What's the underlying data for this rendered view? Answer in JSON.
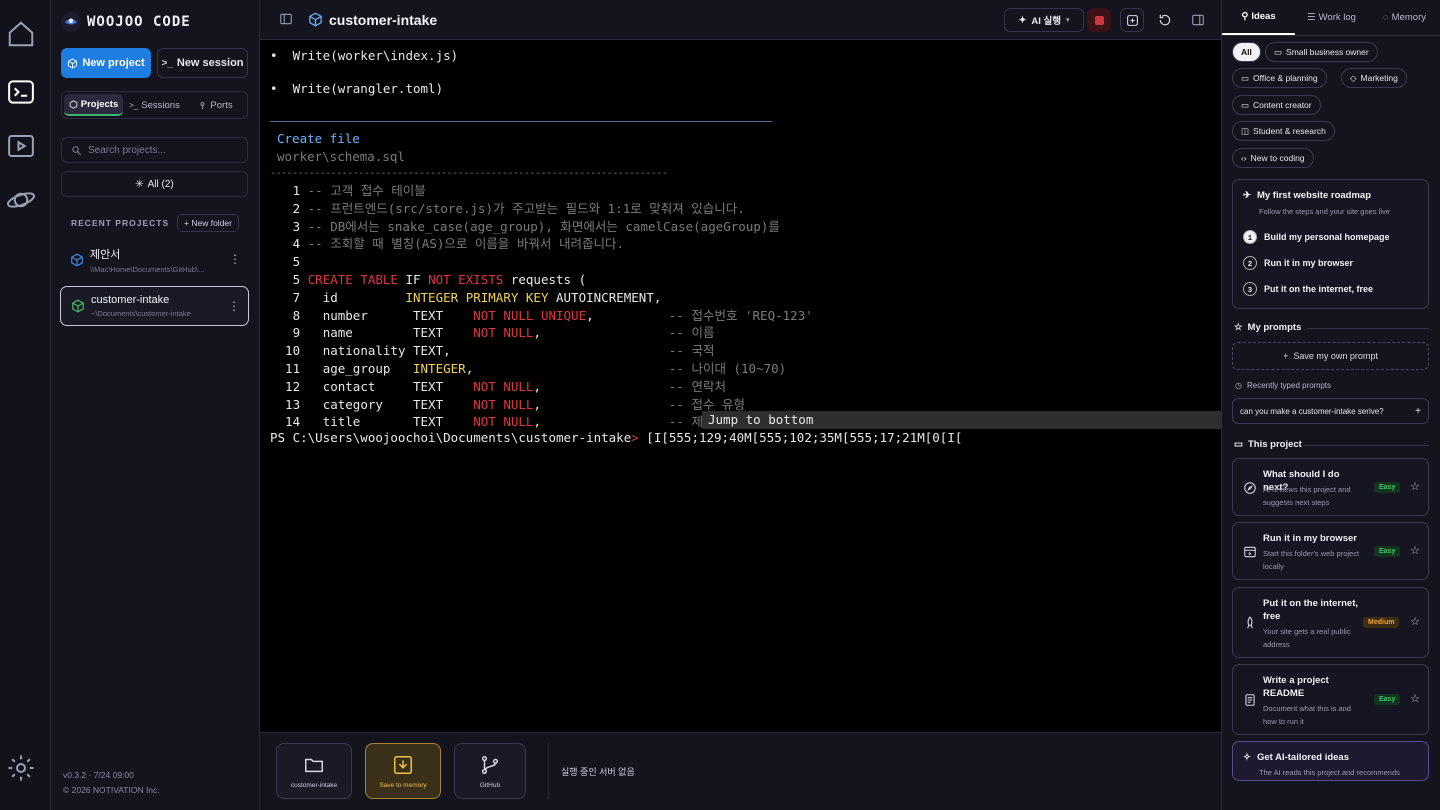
{
  "app": {
    "logo_text": "WOOJOO CODE",
    "version_line": "v0.3.2 · 7/24 09:00",
    "copyright": "© 2026 NOTIVATION Inc."
  },
  "sidebar": {
    "new_project": "New project",
    "new_session": "New session",
    "tabs": [
      {
        "label": "Projects",
        "icon": "cube-icon",
        "active": true
      },
      {
        "label": "Sessions",
        "icon": "terminal-icon",
        "active": false
      },
      {
        "label": "Ports",
        "icon": "pin-icon",
        "active": false
      }
    ],
    "search_placeholder": "Search projects...",
    "filter_label": "All (2)",
    "recent_label": "RECENT PROJECTS",
    "new_folder": "+ New folder",
    "projects": [
      {
        "name": "제안서",
        "path": "\\\\Mac\\Home\\Documents\\GitHub\\...",
        "color": "#3a8ee8",
        "selected": false
      },
      {
        "name": "customer-intake",
        "path": "~\\Documents\\customer-intake",
        "color": "#3ec36e",
        "selected": true
      }
    ]
  },
  "main": {
    "title": "customer-intake",
    "ai_run": "AI 실행",
    "terminal": {
      "write_lines": [
        "Write(worker\\index.js)",
        "Write(wrangler.toml)"
      ],
      "create_file": "Create file",
      "file_path": "worker\\schema.sql",
      "dashes": "------------------------------------------------------------------------",
      "code": [
        {
          "n": "1",
          "comment": "-- 고객 접수 테이블"
        },
        {
          "n": "2",
          "comment": "-- 프런트엔드(src/store.js)가 주고받는 필드와 1:1로 맞춰져 있습니다."
        },
        {
          "n": "3",
          "comment": "-- DB에서는 snake_case(age_group), 화면에서는 camelCase(ageGroup)를"
        },
        {
          "n": "4",
          "comment": "-- 조회할 때 별칭(AS)으로 이름을 바꿔서 내려줍니다."
        },
        {
          "n": "5",
          "comment": ""
        },
        {
          "n": "5",
          "create": "CREATE TABLE",
          "ifw": " IF ",
          "notexists": "NOT EXISTS",
          "rest": " requests ("
        },
        {
          "n": "7",
          "field": "  id         ",
          "type": "INTEGER PRIMARY KEY",
          "extra": " AUTOINCREMENT,",
          "c": ""
        },
        {
          "n": "8",
          "field": "  number      ",
          "plain": "TEXT    ",
          "kw": "NOT NULL UNIQUE",
          "tail": ",          ",
          "c": "-- 접수번호 'REQ-123'"
        },
        {
          "n": "9",
          "field": "  name        ",
          "plain": "TEXT    ",
          "kw": "NOT NULL",
          "tail": ",                 ",
          "c": "-- 이름"
        },
        {
          "n": "10",
          "field": "  nationality ",
          "plain": "TEXT,",
          "kw": "",
          "tail": "                             ",
          "c": "-- 국적"
        },
        {
          "n": "11",
          "field": "  age_group   ",
          "ytype": "INTEGER",
          "tail": ",                          ",
          "c": "-- 나이대 (10~70)"
        },
        {
          "n": "12",
          "field": "  contact     ",
          "plain": "TEXT    ",
          "kw": "NOT NULL",
          "tail": ",                 ",
          "c": "-- 연락처"
        },
        {
          "n": "13",
          "field": "  category    ",
          "plain": "TEXT    ",
          "kw": "NOT NULL",
          "tail": ",                 ",
          "c": "-- 접수 유형"
        },
        {
          "n": "14",
          "field": "  title       ",
          "plain": "TEXT    ",
          "kw": "NOT NULL",
          "tail": ",                 ",
          "c": "-- 제"
        }
      ],
      "jump_to_bottom": "Jump to bottom",
      "prompt": "PS C:\\Users\\woojoochoi\\Documents\\customer-intake",
      "prompt_tail": " [I[555;129;40M[555;102;35M[555;17;21M[0[I["
    },
    "dock": [
      {
        "label": "customer-intake",
        "icon": "folder-icon"
      },
      {
        "label": "Save to memory",
        "icon": "download-box-icon"
      },
      {
        "label": "GitHub",
        "icon": "git-branch-icon"
      }
    ],
    "server_status": "실행 중인 서버 없음"
  },
  "right": {
    "tabs": [
      {
        "label": "Ideas",
        "icon": "bulb-icon",
        "active": true
      },
      {
        "label": "Work log",
        "icon": "list-icon",
        "active": false
      },
      {
        "label": "Memory",
        "icon": "memory-icon",
        "active": false
      }
    ],
    "chips": [
      "All",
      "Small business owner",
      "Office & planning",
      "Marketing",
      "Content creator",
      "Student & research",
      "New to coding"
    ],
    "roadmap": {
      "title": "My first website roadmap",
      "subtitle": "Follow the steps and your site goes live",
      "steps": [
        "Build my personal homepage",
        "Run it in my browser",
        "Put it on the internet, free"
      ]
    },
    "my_prompts": "My prompts",
    "save_prompt": "Save my own prompt",
    "recently_typed": "Recently typed prompts",
    "typed_item": "can you make a customer-intake serive?",
    "this_project": "This project",
    "ideas": [
      {
        "title": "What should I do next?",
        "desc": "AI reviews this project and suggests next steps",
        "badge": "Easy",
        "icon": "compass-icon"
      },
      {
        "title": "Run it in my browser",
        "desc": "Start this folder's web project locally",
        "badge": "Easy",
        "icon": "browser-icon"
      },
      {
        "title": "Put it on the internet, free",
        "desc": "Your site gets a real public address",
        "badge": "Medium",
        "icon": "rocket-icon"
      },
      {
        "title": "Write a project README",
        "desc": "Document what this is and how to run it",
        "badge": "Easy",
        "icon": "document-icon"
      }
    ],
    "tailored_title": "Get AI-tailored ideas",
    "tailored_desc": "The AI reads this project and recommends"
  }
}
